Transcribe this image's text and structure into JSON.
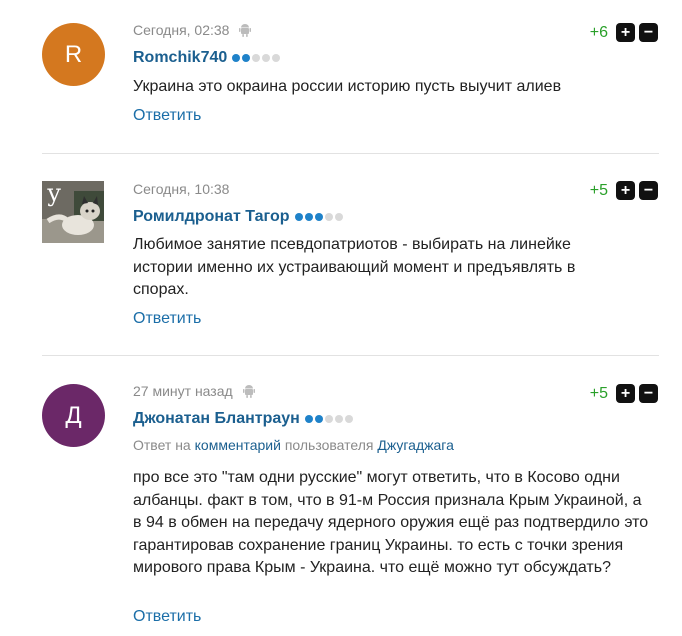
{
  "colors": {
    "link": "#1b5f8f",
    "score_positive": "#2aa02a",
    "rating_dot_on": "#1f82c9",
    "rating_dot_off": "#d9d9d9",
    "avatar_romchik": "#d4781f",
    "avatar_dzhonatan": "#6b2868"
  },
  "actions": {
    "reply_label": "Ответить"
  },
  "comments": [
    {
      "time": "Сегодня, 02:38",
      "device_icon": "android-icon",
      "author": "Romchik740",
      "avatar_letter": "R",
      "rating_level": 2,
      "rating_max": 5,
      "score": "+6",
      "text": "Украина это окраина россии историю пусть выучит алиев"
    },
    {
      "time": "Сегодня, 10:38",
      "author": "Ромилдронат Тагор",
      "avatar_letter": "у",
      "rating_level": 3,
      "rating_max": 5,
      "score": "+5",
      "text": "Любимое занятие псевдопатриотов - выбирать на линейке истории именно их устраивающий момент и предъявлять в спорах."
    },
    {
      "time": "27 минут назад",
      "device_icon": "android-icon",
      "author": "Джонатан Блантраун",
      "avatar_letter": "Д",
      "rating_level": 2,
      "rating_max": 5,
      "score": "+5",
      "reply_prefix": "Ответ на",
      "reply_link": "комментарий",
      "reply_mid": "пользователя",
      "reply_user": "Джугаджага",
      "text": "про все это \"там одни русские\" могут ответить, что в Косово одни албанцы. факт в том, что в 91-м Россия признала Крым Украиной, а в 94 в обмен на передачу ядерного оружия ещё раз подтвердило это гарантировав сохранение границ Украины. то есть с точки зрения мирового права Крым - Украина. что ещё можно тут обсуждать?"
    }
  ]
}
